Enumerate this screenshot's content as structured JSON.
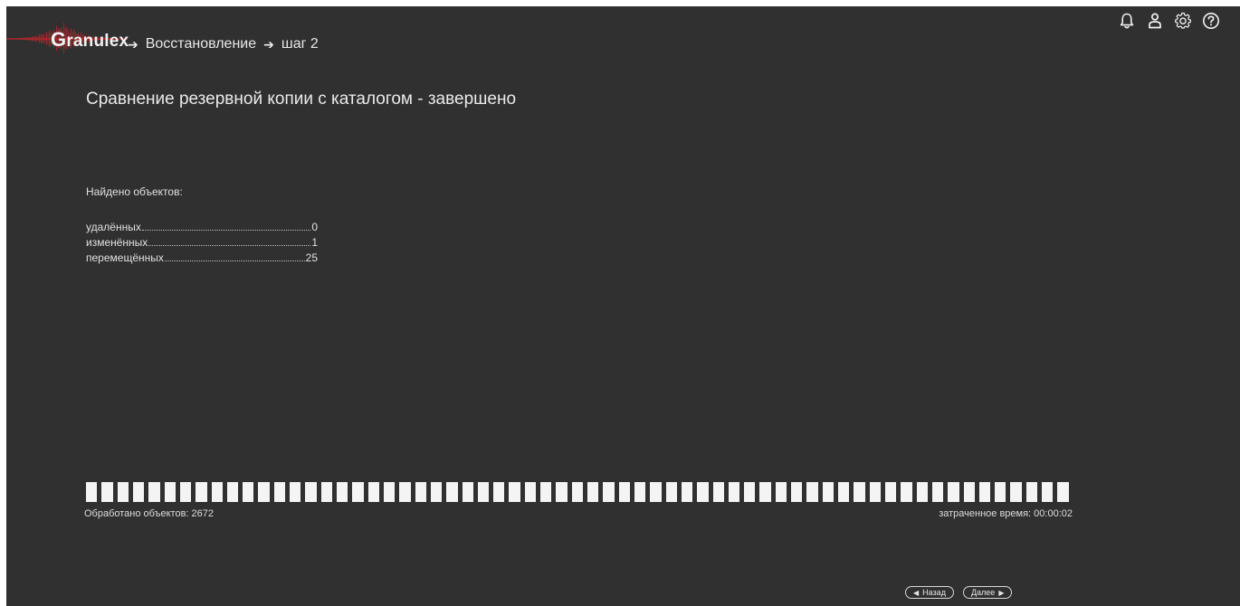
{
  "app": {
    "name": "Granulex",
    "accent_color": "#c0262b",
    "background": "#303030"
  },
  "breadcrumb": {
    "items": [
      "Восстановление",
      "шаг 2"
    ]
  },
  "header_icons": [
    "bell-icon",
    "user-icon",
    "gear-icon",
    "help-icon"
  ],
  "page": {
    "title": "Сравнение резервной копии с каталогом - завершено",
    "found_label": "Найдено объектов:",
    "stats": [
      {
        "label": "удалённых",
        "value": "0"
      },
      {
        "label": "изменённых",
        "value": "1"
      },
      {
        "label": "перемещённых",
        "value": "25"
      }
    ]
  },
  "progress": {
    "fraction": 1.0,
    "segments": 63,
    "processed_text": "Обработано объектов: 2672",
    "elapsed_text": "затраченное время: 00:00:02"
  },
  "nav": {
    "back_label": "Назад",
    "next_label": "Далее"
  }
}
